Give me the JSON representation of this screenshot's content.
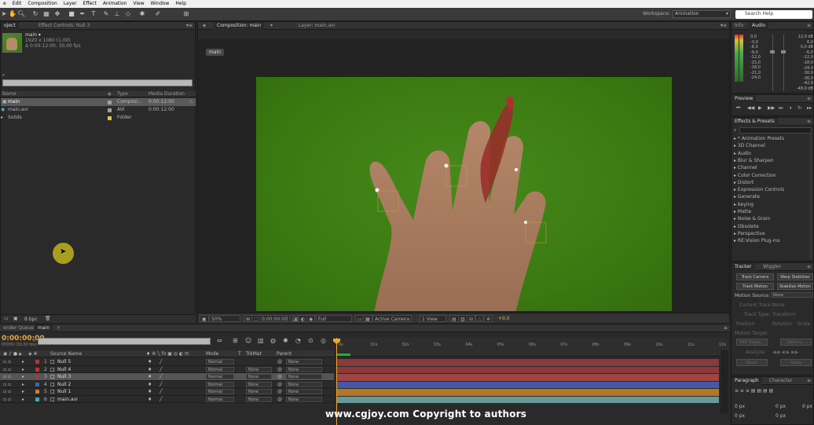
{
  "menu": [
    "e",
    "Edit",
    "Composition",
    "Layer",
    "Effect",
    "Animation",
    "View",
    "Window",
    "Help"
  ],
  "toolbar": {
    "workspace_label": "Workspace:",
    "workspace_value": "Animation",
    "search_placeholder": "Search Help"
  },
  "project": {
    "tabs": [
      "oject",
      "Effect Controls: Null 3"
    ],
    "item_name": "main ▾",
    "item_size": "1920 x 1080 (1,00)",
    "item_duration": "Δ 0:00:12:00, 30,00 fps",
    "columns": [
      "Name",
      "Type",
      "Media Duration"
    ],
    "items": [
      {
        "name": "main",
        "type": "Composi...",
        "duration": "0:00:12:00",
        "swatch": "#a0a0a0",
        "selected": true
      },
      {
        "name": "main.avi",
        "type": "AVI",
        "duration": "0:00:12:00",
        "swatch": "#a0a0a0",
        "selected": false
      },
      {
        "name": "Solids",
        "type": "Folder",
        "duration": "",
        "swatch": "#d8c840",
        "selected": false
      }
    ],
    "bpc": "8 bpc"
  },
  "comp": {
    "tabs": [
      "Composition: main",
      "Layer: main.avi"
    ],
    "breadcrumb": "main",
    "zoom": "50%",
    "timecode": "0:00:00:00",
    "resolution": "Full",
    "camera": "Active Camera",
    "views": "1 View",
    "exposure": "+0,0"
  },
  "right": {
    "info_tabs": [
      "Info",
      "Audio"
    ],
    "audio_db_left": [
      "0,0",
      "-3,0",
      "-6,0",
      "-9,0",
      "-12,0",
      "-15,0",
      "-18,0",
      "-21,0",
      "-24,0"
    ],
    "audio_db_right": [
      "12,0 dB",
      "6,0",
      "0,0 dB",
      "-6,0",
      "-12,0",
      "-18,0",
      "-24,0",
      "-30,0",
      "-36,0",
      "-42,0",
      "-48,0 dB"
    ],
    "preview_tab": "Preview",
    "effects_tab": "Effects & Presets",
    "effects": [
      "* Animation Presets",
      "3D Channel",
      "Audio",
      "Blur & Sharpen",
      "Channel",
      "Color Correction",
      "Distort",
      "Expression Controls",
      "Generate",
      "Keying",
      "Matte",
      "Noise & Grain",
      "Obsolete",
      "Perspective",
      "RE:Vision Plug-ins"
    ],
    "tracker_tabs": [
      "Tracker",
      "Wiggler"
    ],
    "tracker_buttons": [
      "Track Camera",
      "Warp Stabilizer",
      "Track Motion",
      "Stabilize Motion"
    ],
    "motion_source_label": "Motion Source:",
    "motion_source_value": "None",
    "current_track_label": "Current Track:",
    "current_track_value": "None",
    "track_type_label": "Track Type:",
    "track_type_value": "Transform",
    "track_options": [
      "Position",
      "Rotation",
      "Scale"
    ],
    "motion_target_label": "Motion Target:",
    "edit_target": "Edit Target...",
    "options": "Options...",
    "analyze_label": "Analyze:",
    "reset": "Reset",
    "apply": "Apply",
    "para_tabs": [
      "Paragraph",
      "Character"
    ],
    "para_values": [
      "0 px",
      "0 px",
      "0 px",
      "0 px",
      "0 px"
    ]
  },
  "timeline": {
    "tabs": [
      "ender Queue",
      "main"
    ],
    "timecode": "0:00:00:00",
    "fps": "00000 (30.00 fps)",
    "columns": [
      "Source Name",
      "Mode",
      "T",
      "TrkMat",
      "Parent"
    ],
    "layers": [
      {
        "num": "1",
        "name": "Null 5",
        "label": "#c03030",
        "mode": "Normal",
        "trkmat": "",
        "parent": "None",
        "selected": false,
        "bar": "#8a3a3a"
      },
      {
        "num": "2",
        "name": "Null 4",
        "label": "#c03030",
        "mode": "Normal",
        "trkmat": "None",
        "parent": "None",
        "selected": false,
        "bar": "#8a3a3a"
      },
      {
        "num": "3",
        "name": "Null 3",
        "label": "#c03030",
        "mode": "Normal",
        "trkmat": "None",
        "parent": "None",
        "selected": true,
        "bar": "#a04545"
      },
      {
        "num": "4",
        "name": "Null 2",
        "label": "#4060c0",
        "mode": "Normal",
        "trkmat": "None",
        "parent": "None",
        "selected": false,
        "bar": "#4858a8"
      },
      {
        "num": "5",
        "name": "Null 1",
        "label": "#d08020",
        "mode": "Normal",
        "trkmat": "None",
        "parent": "None",
        "selected": false,
        "bar": "#b07828"
      },
      {
        "num": "6",
        "name": "main.avi",
        "label": "#30b0b0",
        "mode": "Normal",
        "trkmat": "None",
        "parent": "None",
        "selected": false,
        "bar": "#6a9a98"
      }
    ],
    "ruler_ticks": [
      "0s",
      "01s",
      "02s",
      "03s",
      "04s",
      "05s",
      "06s",
      "07s",
      "08s",
      "09s",
      "10s",
      "11s",
      "12s"
    ]
  },
  "watermark": "www.cgjoy.com Copyright to authors"
}
